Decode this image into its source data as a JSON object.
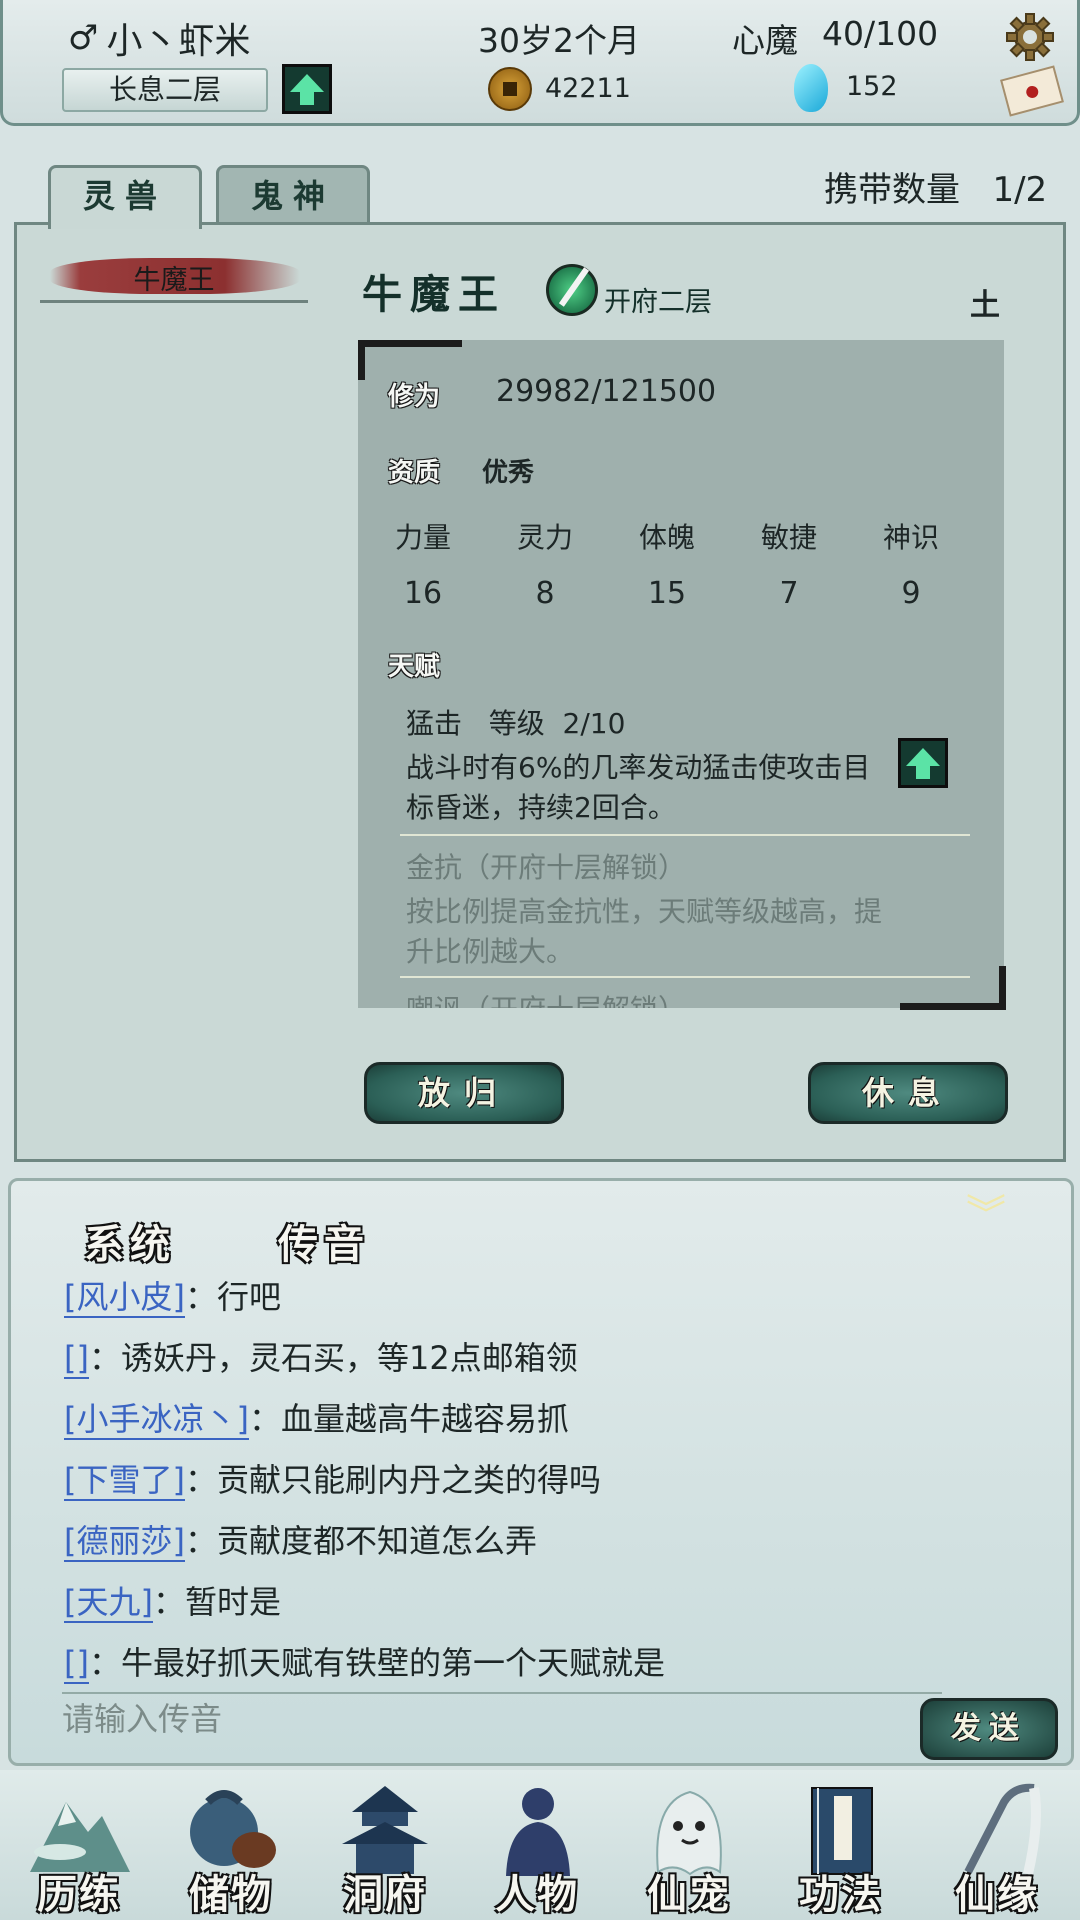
{
  "header": {
    "gender_symbol": "♂",
    "player_name": "小丶虾米",
    "age": "30岁2个月",
    "heart_demon_label": "心魔",
    "heart_demon_value": "40/100",
    "realm": "长息二层",
    "coins": "42211",
    "gems": "152"
  },
  "tabs": [
    {
      "label": "灵兽",
      "active": true
    },
    {
      "label": "鬼神",
      "active": false
    }
  ],
  "carry": {
    "label": "携带数量",
    "value": "1/2"
  },
  "pet_list": [
    {
      "name": "牛魔王"
    }
  ],
  "pet": {
    "name": "牛魔王",
    "realm": "开府二层",
    "element": "土",
    "cultivation_label": "修为",
    "cultivation_value": "29982/121500",
    "aptitude_label": "资质",
    "aptitude_value": "优秀",
    "stats": [
      {
        "name": "力量",
        "value": "16"
      },
      {
        "name": "灵力",
        "value": "8"
      },
      {
        "name": "体魄",
        "value": "15"
      },
      {
        "name": "敏捷",
        "value": "7"
      },
      {
        "name": "神识",
        "value": "9"
      }
    ],
    "talent_label": "天赋",
    "talents": [
      {
        "title": "猛击   等级  2/10",
        "desc": "战斗时有6%的几率发动猛击使攻击目标昏迷，持续2回合。",
        "locked": false
      },
      {
        "title": "金抗（开府十层解锁）",
        "desc": "按比例提高金抗性，天赋等级越高，提升比例越大。",
        "locked": true
      },
      {
        "title": "嘲讽（开府十层解锁）",
        "desc": "",
        "locked": true
      }
    ]
  },
  "actions": {
    "release": "放归",
    "rest": "休息"
  },
  "chat": {
    "tabs": [
      "系统",
      "传音"
    ],
    "messages": [
      {
        "user": "[风小皮]",
        "text": "：行吧"
      },
      {
        "user": "[]",
        "text": "：诱妖丹，灵石买，等12点邮箱领"
      },
      {
        "user": "[小手冰凉丶]",
        "text": "：血量越高牛越容易抓"
      },
      {
        "user": "[下雪了]",
        "text": "：贡献只能刷内丹之类的得吗"
      },
      {
        "user": "[德丽莎]",
        "text": "：贡献度都不知道怎么弄"
      },
      {
        "user": "[天九]",
        "text": "：暂时是"
      },
      {
        "user": "[]",
        "text": "：牛最好抓天赋有铁壁的第一个天赋就是"
      }
    ],
    "input_placeholder": "请输入传音",
    "send_label": "发送"
  },
  "nav": [
    {
      "label": "历练",
      "icon": "mountain-icon"
    },
    {
      "label": "储物",
      "icon": "bag-icon"
    },
    {
      "label": "洞府",
      "icon": "pagoda-icon"
    },
    {
      "label": "人物",
      "icon": "person-icon"
    },
    {
      "label": "仙宠",
      "icon": "ghost-pet-icon"
    },
    {
      "label": "功法",
      "icon": "book-icon"
    },
    {
      "label": "仙缘",
      "icon": "crane-icon"
    }
  ]
}
